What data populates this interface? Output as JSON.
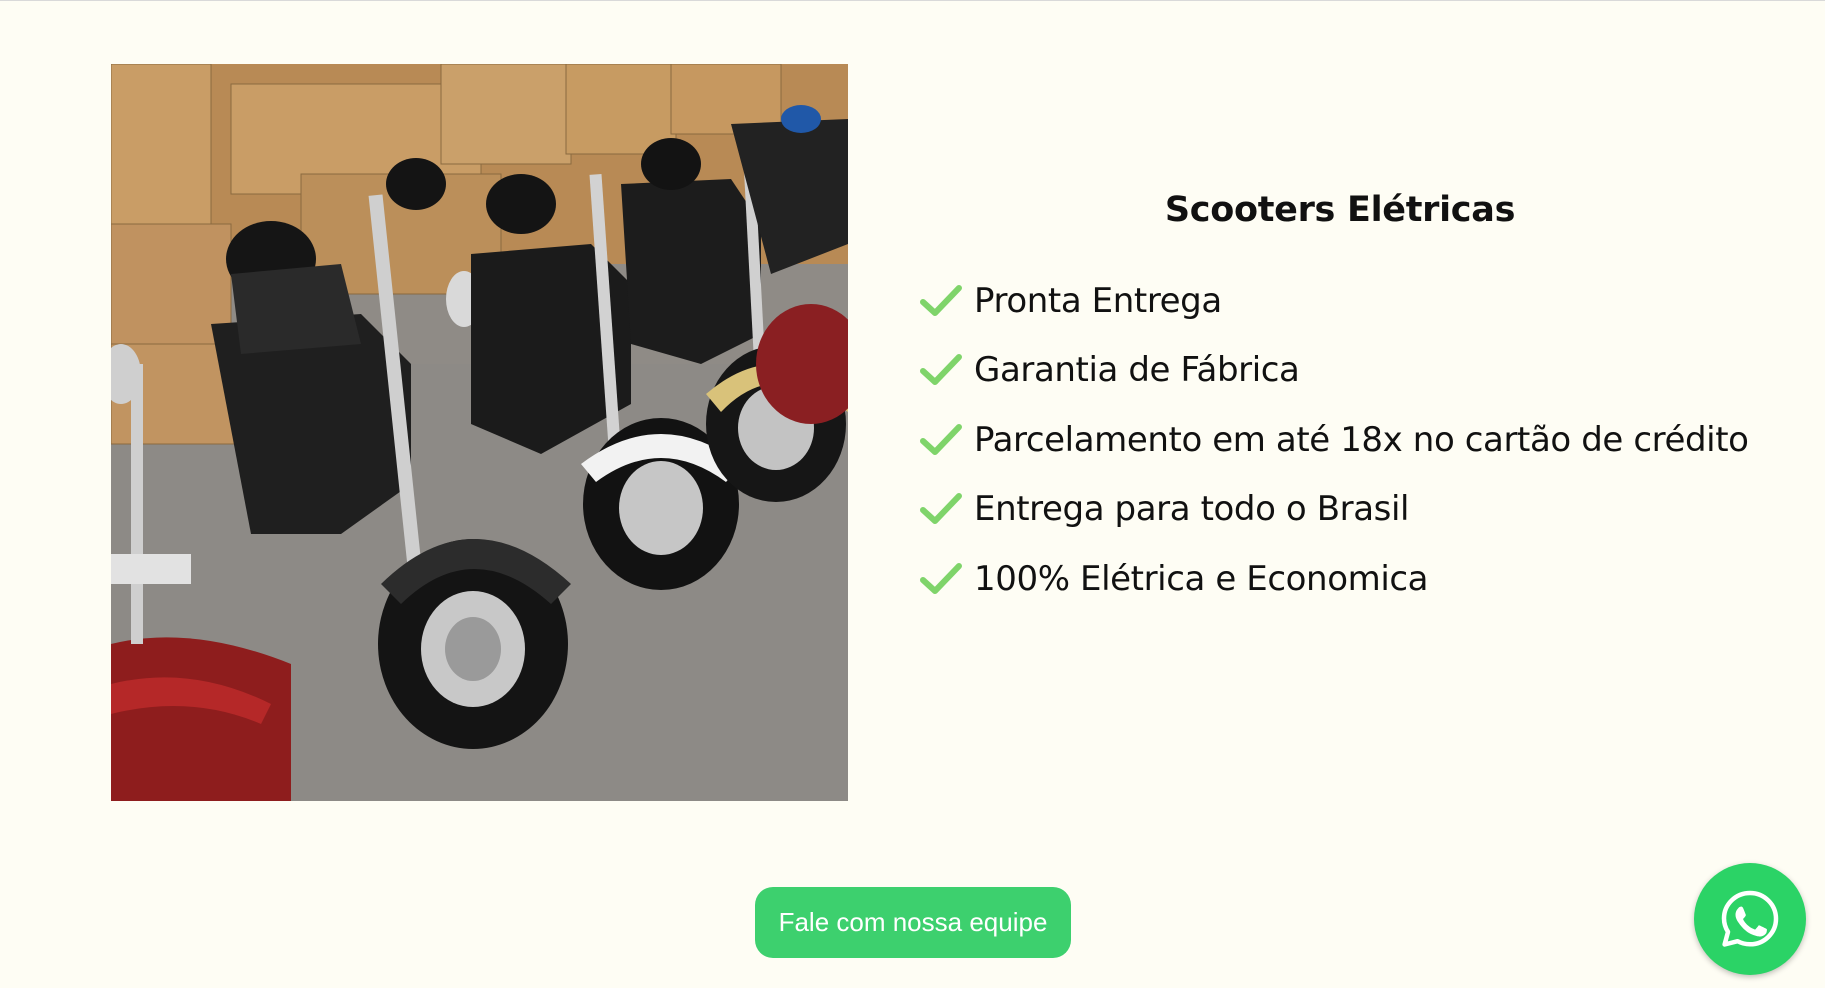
{
  "hero_image": {
    "description_icon": "scooters-photo",
    "alt": "Scooters elétricas no armazém"
  },
  "section": {
    "title": "Scooters Elétricas",
    "features": [
      {
        "icon": "check-icon",
        "text": "Pronta Entrega"
      },
      {
        "icon": "check-icon",
        "text": "Garantia de Fábrica"
      },
      {
        "icon": "check-icon",
        "text": "Parcelamento em até 18x no cartão de crédito"
      },
      {
        "icon": "check-icon",
        "text": "Entrega para todo o Brasil"
      },
      {
        "icon": "check-icon",
        "text": "100% Elétrica e Economica"
      }
    ]
  },
  "cta": {
    "label": "Fale com nossa equipe"
  },
  "whatsapp": {
    "icon": "whatsapp-icon"
  },
  "colors": {
    "background": "#fefdf4",
    "check": "#7fd46a",
    "cta": "#3dd06e",
    "whatsapp": "#2bd366",
    "text": "#111111"
  }
}
